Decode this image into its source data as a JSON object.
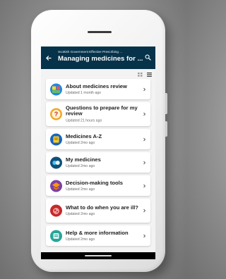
{
  "appbar": {
    "subtitle": "Scottish Government Effective Prescribing ...",
    "title": "Managing medicines for ..."
  },
  "icons": {
    "back": "arrow-left-icon",
    "search": "search-icon",
    "grid_view": "grid-view-icon",
    "list_view": "list-view-icon",
    "chevron": "chevron-right-icon"
  },
  "items": [
    {
      "title": "About medicines review",
      "updated": "Updated 1 month ago",
      "icon": "puzzle-icon",
      "color": "#1e88e5"
    },
    {
      "title": "Questions to prepare for my review",
      "updated": "Updated 21 hours ago",
      "icon": "question-icon",
      "color": "#f5a623"
    },
    {
      "title": "Medicines A-Z",
      "updated": "Updated 2mo ago",
      "icon": "book-icon",
      "color": "#1565c0"
    },
    {
      "title": "My medicines",
      "updated": "Updated 2mo ago",
      "icon": "pills-icon",
      "color": "#0e4f7a"
    },
    {
      "title": "Decision-making tools",
      "updated": "Updated 2mo ago",
      "icon": "toolbox-icon",
      "color": "#7b3fa6"
    },
    {
      "title": "What to do when you are ill?",
      "updated": "Updated 2mo ago",
      "icon": "thermometer-icon",
      "color": "#c62828"
    },
    {
      "title": "Help & more information",
      "updated": "Updated 2mo ago",
      "icon": "help-icon",
      "color": "#26a69a"
    }
  ]
}
